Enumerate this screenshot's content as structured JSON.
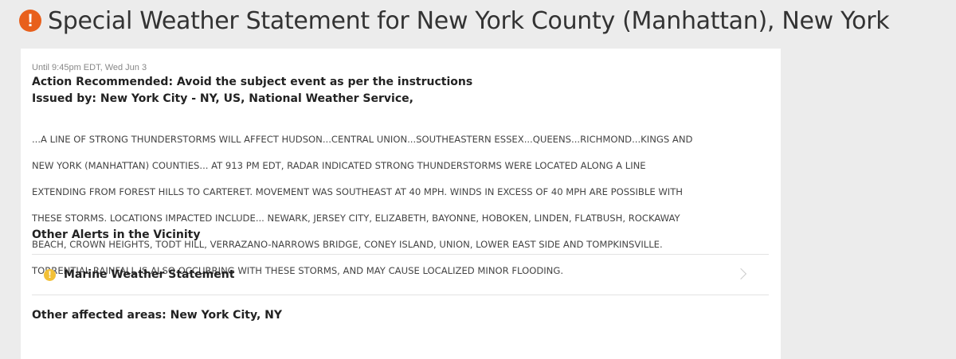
{
  "header": {
    "icon": "exclamation-circle-icon",
    "icon_glyph": "!",
    "icon_color": "#e8601c",
    "title": "Special Weather Statement for New York County (Manhattan), New York"
  },
  "statement": {
    "until": "Until 9:45pm EDT, Wed Jun 3",
    "action": "Action Recommended: Avoid the subject event as per the instructions",
    "issued_by": "Issued by: New York City - NY, US, National Weather Service,",
    "body_lines": [
      "...A LINE OF STRONG THUNDERSTORMS WILL AFFECT HUDSON...CENTRAL UNION...SOUTHEASTERN ESSEX...QUEENS...RICHMOND...KINGS AND",
      "NEW YORK (MANHATTAN) COUNTIES... AT 913 PM EDT, RADAR INDICATED STRONG THUNDERSTORMS WERE LOCATED ALONG A LINE",
      "EXTENDING FROM FOREST HILLS TO CARTERET. MOVEMENT WAS SOUTHEAST AT 40 MPH. WINDS IN EXCESS OF 40 MPH ARE POSSIBLE WITH",
      "THESE STORMS. LOCATIONS IMPACTED INCLUDE... NEWARK, JERSEY CITY, ELIZABETH, BAYONNE, HOBOKEN, LINDEN, FLATBUSH, ROCKAWAY",
      "BEACH, CROWN HEIGHTS, TODT HILL, VERRAZANO-NARROWS BRIDGE, CONEY ISLAND, UNION, LOWER EAST SIDE AND TOMPKINSVILLE.",
      "TORRENTIAL RAINFALL IS ALSO OCCURRING WITH THESE STORMS, AND MAY CAUSE LOCALIZED MINOR FLOODING."
    ]
  },
  "vicinity": {
    "title": "Other Alerts in the Vicinity",
    "alerts": [
      {
        "label": "Marine Weather Statement",
        "icon": "exclamation-circle-icon",
        "icon_glyph": "!",
        "icon_color": "#f2c037",
        "chevron": "chevron-right-icon"
      }
    ]
  },
  "other_areas": "Other affected areas: New York City, NY"
}
